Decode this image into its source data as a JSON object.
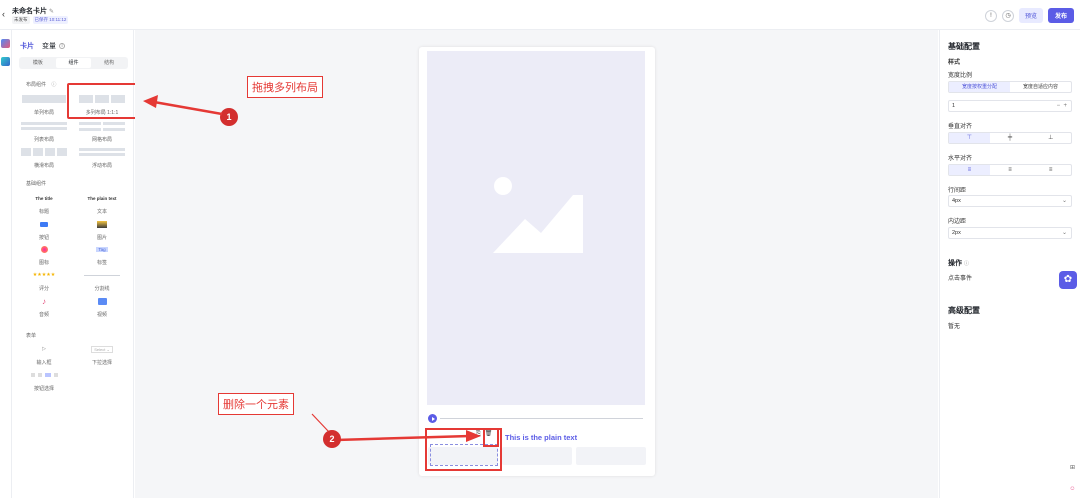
{
  "header": {
    "back_icon": "chevron-left-icon",
    "title": "未命名卡片",
    "edit_icon": "edit-icon",
    "status_tag": "未发布",
    "saved_tag": "已保存 10:11:12",
    "preview_label": "预览",
    "publish_label": "发布"
  },
  "left_panel": {
    "tab_card": "卡片",
    "tab_vars": "变量",
    "seg_template": "模板",
    "seg_components": "组件",
    "seg_structure": "结构",
    "layout_section": "布局组件",
    "layout_items": [
      "单列布局",
      "多列布局 1:1:1",
      "列表布局",
      "网格布局",
      "横滑布局",
      "浮动布局"
    ],
    "basic_section": "基础组件",
    "basic_title_sample": "The title",
    "basic_text_sample": "The plain text",
    "tag_sample": "Tag",
    "basic_items": [
      "标题",
      "文本",
      "按钮",
      "图片",
      "图标",
      "标签",
      "评分",
      "分割线",
      "音频",
      "视频"
    ],
    "form_section": "表单",
    "select_sample": "Select",
    "form_items": [
      "输入框",
      "下拉选择",
      "按钮选择"
    ],
    "rating_stars": "★★★★★"
  },
  "canvas": {
    "plain_text": "This is the plain text"
  },
  "annotations": {
    "callout_1": "拖拽多列布局",
    "callout_2": "删除一个元素",
    "badge_1": "1",
    "badge_2": "2"
  },
  "right_panel": {
    "basic_config": "基础配置",
    "style": "样式",
    "width_ratio": "宽度比例",
    "width_opt_1": "宽度按权重分配",
    "width_opt_2": "宽度自适应内容",
    "weight_value": "1",
    "vertical_align": "垂直对齐",
    "horizontal_align": "水平对齐",
    "row_gap": "行间距",
    "row_gap_value": "4px",
    "padding": "内边距",
    "padding_value": "2px",
    "operation": "操作",
    "click_event": "点击事件",
    "advanced_config": "高级配置",
    "none": "暂无"
  },
  "colors": {
    "accent": "#5b5ce6",
    "annotation_red": "#e53935"
  }
}
